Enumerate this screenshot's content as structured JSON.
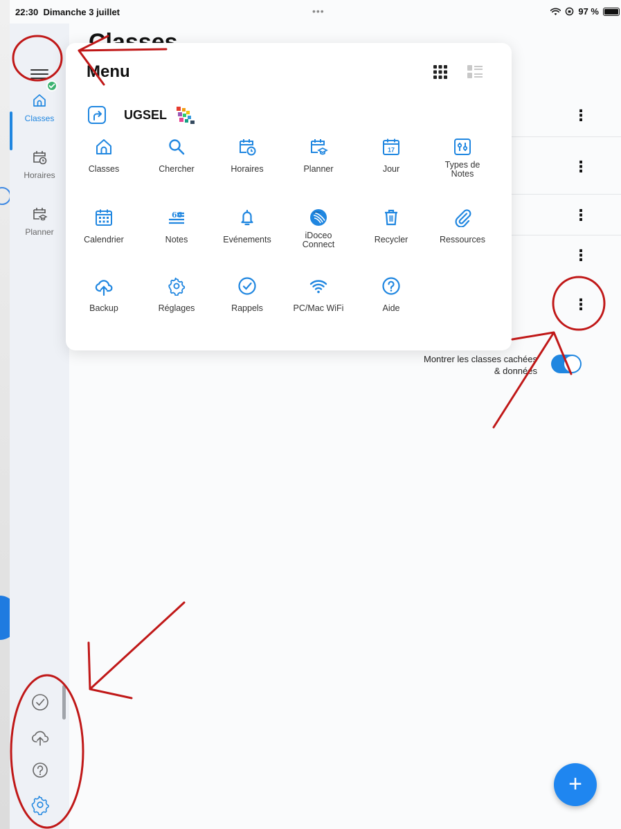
{
  "status_bar": {
    "time": "22:30",
    "date": "Dimanche 3 juillet",
    "battery": "97 %"
  },
  "sidebar": {
    "items": [
      {
        "label": "Classes",
        "icon": "home-icon",
        "active": true
      },
      {
        "label": "Horaires",
        "icon": "calendar-clock-icon",
        "active": false
      },
      {
        "label": "Planner",
        "icon": "calendar-hat-icon",
        "active": false
      }
    ],
    "bottom_icons": [
      "check-circle-icon",
      "cloud-upload-icon",
      "help-icon",
      "settings-icon"
    ]
  },
  "main": {
    "title": "Classes",
    "hidden_classes_label_line1": "Montrer les classes cachées",
    "hidden_classes_label_line2": "& données",
    "toggle_on": true,
    "fab_label": "+"
  },
  "menu": {
    "title": "Menu",
    "account_label": "UGSEL",
    "items": [
      {
        "label": "Classes",
        "icon": "home-icon"
      },
      {
        "label": "Chercher",
        "icon": "search-icon"
      },
      {
        "label": "Horaires",
        "icon": "calendar-clock-icon"
      },
      {
        "label": "Planner",
        "icon": "calendar-hat-icon"
      },
      {
        "label": "Jour",
        "icon": "calendar-day-icon",
        "day": "17"
      },
      {
        "label": "Types de Notes",
        "icon": "grade-types-icon",
        "line1": "Types de",
        "line2": "Notes"
      },
      {
        "label": "Calendrier",
        "icon": "calendar-grid-icon"
      },
      {
        "label": "Notes",
        "icon": "notes-icon"
      },
      {
        "label": "Evénements",
        "icon": "bell-icon"
      },
      {
        "label": "iDoceo Connect",
        "icon": "idoceo-connect-icon",
        "line1": "iDoceo",
        "line2": "Connect"
      },
      {
        "label": "Recycler",
        "icon": "trash-icon"
      },
      {
        "label": "Ressources",
        "icon": "paperclip-icon"
      },
      {
        "label": "Backup",
        "icon": "cloud-upload-icon"
      },
      {
        "label": "Réglages",
        "icon": "settings-icon"
      },
      {
        "label": "Rappels",
        "icon": "check-circle-icon"
      },
      {
        "label": "PC/Mac WiFi",
        "icon": "wifi-icon"
      },
      {
        "label": "Aide",
        "icon": "help-icon"
      }
    ]
  },
  "colors": {
    "accent": "#1f86e0",
    "annotation": "#c01818",
    "success": "#3cb371"
  }
}
